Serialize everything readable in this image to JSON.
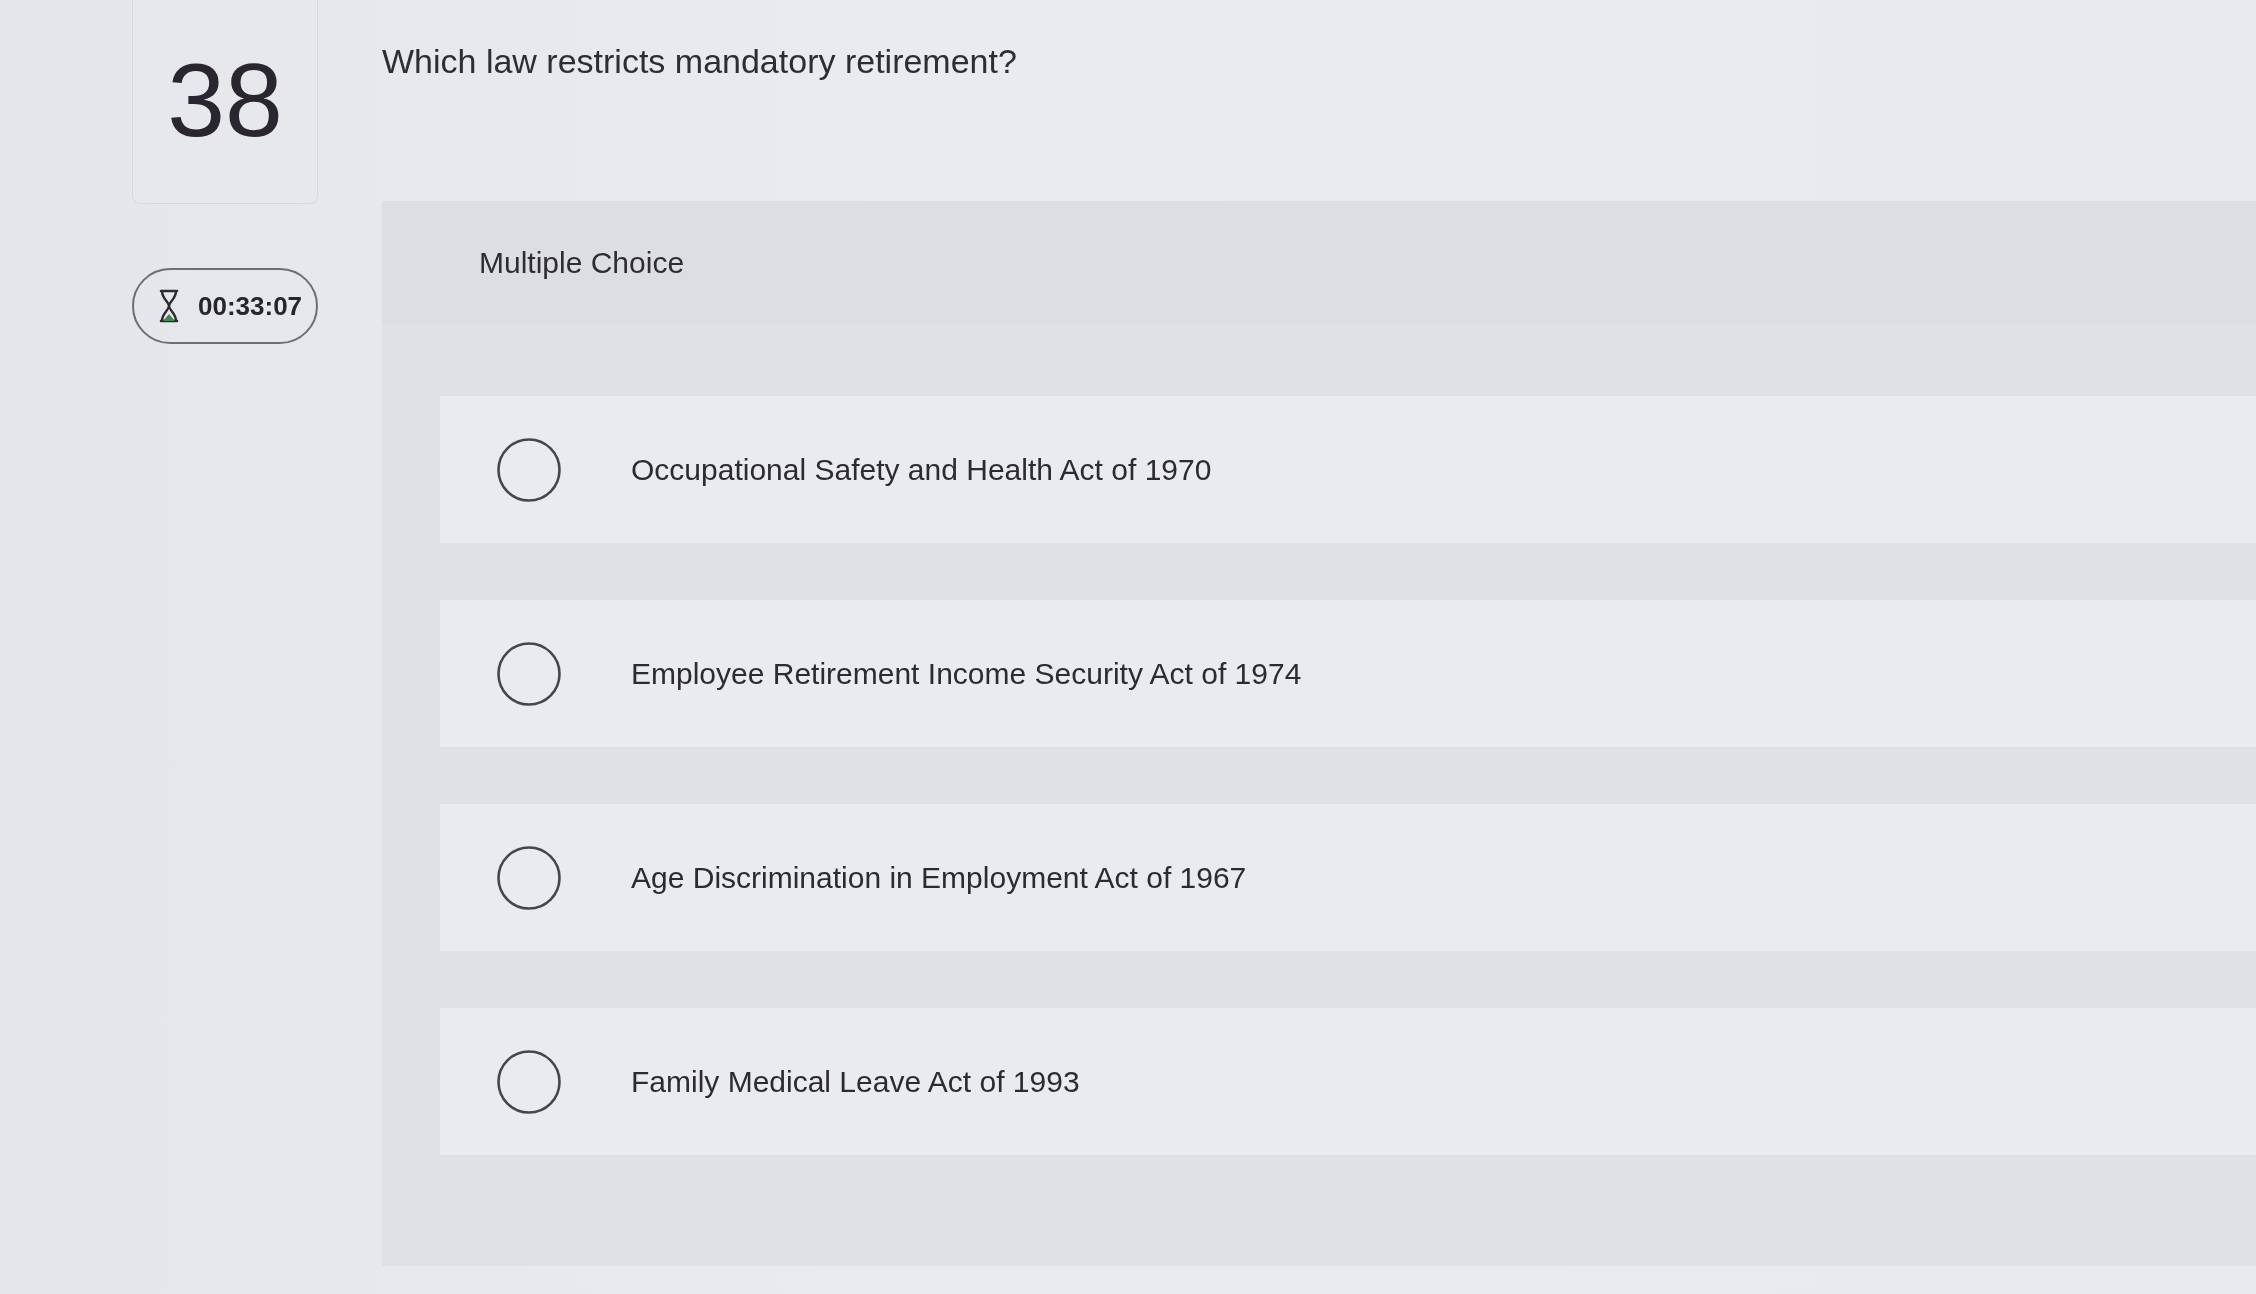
{
  "question_number": "38",
  "timer": {
    "time": "00:33:07"
  },
  "question": "Which law restricts mandatory retirement?",
  "question_type": "Multiple Choice",
  "options": [
    {
      "label": "Occupational Safety and Health Act of 1970",
      "selected": false
    },
    {
      "label": "Employee Retirement Income Security Act of 1974",
      "selected": false
    },
    {
      "label": "Age Discrimination in Employment Act of 1967",
      "selected": false
    },
    {
      "label": "Family Medical Leave Act of 1993",
      "selected": false
    }
  ]
}
